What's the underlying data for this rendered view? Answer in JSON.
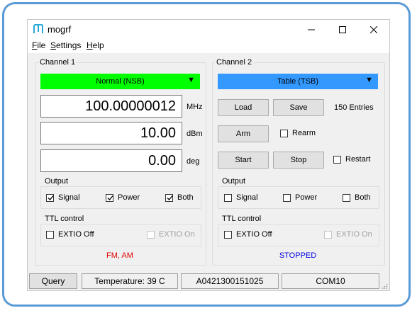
{
  "app": {
    "title": "mogrf"
  },
  "menu": {
    "file": "File",
    "settings": "Settings",
    "help": "Help"
  },
  "channel1": {
    "title": "Channel 1",
    "mode": "Normal (NSB)",
    "mode_color": "#00ff00",
    "frequency": "100.00000012",
    "frequency_unit": "MHz",
    "power": "10.00",
    "power_unit": "dBm",
    "phase": "0.00",
    "phase_unit": "deg",
    "output_title": "Output",
    "signal_label": "Signal",
    "power_label": "Power",
    "both_label": "Both",
    "signal_checked": true,
    "power_checked": true,
    "both_checked": true,
    "ttl_title": "TTL control",
    "extio_off_label": "EXTIO Off",
    "extio_on_label": "EXTIO On",
    "status": "FM, AM",
    "status_color": "#e00000"
  },
  "channel2": {
    "title": "Channel 2",
    "mode": "Table (TSB)",
    "mode_color": "#3399ff",
    "load_label": "Load",
    "save_label": "Save",
    "entries": "150 Entries",
    "arm_label": "Arm",
    "rearm_label": "Rearm",
    "start_label": "Start",
    "stop_label": "Stop",
    "restart_label": "Restart",
    "output_title": "Output",
    "signal_label": "Signal",
    "power_label": "Power",
    "both_label": "Both",
    "ttl_title": "TTL control",
    "extio_off_label": "EXTIO Off",
    "extio_on_label": "EXTIO On",
    "status": "STOPPED",
    "status_color": "#0000e0"
  },
  "statusbar": {
    "query_label": "Query",
    "temperature": "Temperature: 39 C",
    "serial": "A0421300151025",
    "port": "COM10"
  }
}
